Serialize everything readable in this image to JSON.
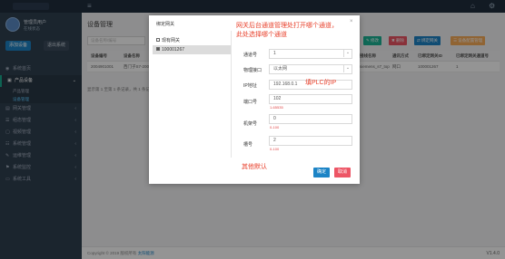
{
  "topbar": {
    "menu_icon": "≡",
    "home_icon": "⌂",
    "user_icon": "⚙"
  },
  "sidebar": {
    "user_name": "管理员用户",
    "user_status": "在线状态",
    "btn_primary": "添加设备",
    "btn_secondary": "退出系统",
    "items": [
      {
        "icon": "◉",
        "label": "系统首页",
        "chevron": ""
      },
      {
        "icon": "▣",
        "label": "产品设备",
        "chevron": "⌄"
      },
      {
        "icon": "",
        "label": "产品管理",
        "chevron": ""
      },
      {
        "icon": "",
        "label": "设备管理",
        "chevron": ""
      },
      {
        "icon": "▤",
        "label": "网关管理",
        "chevron": "‹"
      },
      {
        "icon": "☰",
        "label": "组态管理",
        "chevron": "‹"
      },
      {
        "icon": "▢",
        "label": "视频管理",
        "chevron": "‹"
      },
      {
        "icon": "☷",
        "label": "系统管理",
        "chevron": "‹"
      },
      {
        "icon": "✎",
        "label": "运维管理",
        "chevron": "‹"
      },
      {
        "icon": "⚑",
        "label": "系统监控",
        "chevron": "‹"
      },
      {
        "icon": "▭",
        "label": "系统工具",
        "chevron": "‹"
      }
    ]
  },
  "main": {
    "title": "设备管理",
    "search_placeholder": "设备名称/编号",
    "toolbar": {
      "edit": "✎ 修改",
      "delete": "✖ 删除",
      "bind": "⇄ 绑定网关",
      "config": "☰ 设备配置管理"
    },
    "table": {
      "headers": [
        "设备编号",
        "设备名称",
        "",
        "",
        "",
        "",
        "",
        "",
        "",
        "接线名称",
        "通讯方式",
        "已绑定网关ID",
        "已绑定网关通道号"
      ],
      "row": [
        "2004901001",
        "西门子S7-200",
        "",
        "",
        "",
        "",
        "",
        "",
        "",
        "siemens_s7_top",
        "网口",
        "100001267",
        "1"
      ]
    },
    "pager": "显示第 1 至第 1 条记录，共 1 条记录",
    "footer_copy": "Copyright © 2019 版权所有 ",
    "footer_link": "太阳能源",
    "version": "V1.4.0"
  },
  "modal": {
    "title": "绑定网关",
    "close": "×",
    "left_items": [
      {
        "label": "现有网关",
        "checked": false
      },
      {
        "label": "100001267",
        "checked": true
      }
    ],
    "fields": {
      "channel_label": "通道号",
      "channel_value": "1",
      "port_label": "物理接口",
      "port_value": "以太网",
      "ip_label": "IP地址",
      "ip_value": "192.168.0.1",
      "portnum_label": "端口号",
      "portnum_value": "102",
      "portnum_hint": "1-65535",
      "rack_label": "机架号",
      "rack_value": "0",
      "rack_hint": "0-100",
      "slot_label": "槽号",
      "slot_value": "2",
      "slot_hint": "0-100"
    },
    "ok": "确定",
    "cancel": "取消"
  },
  "annotations": {
    "top_line1": "网关后台通道管理处打开哪个通道，",
    "top_line2": "此处选择哪个通道",
    "ip_note": "填PLC的IP",
    "bottom_note": "其他默认"
  },
  "colors": {
    "primary": "#1c84c6",
    "danger": "#ed5565",
    "warning": "#f8ac59",
    "success": "#1ab394",
    "annotation": "#e8412c",
    "sidebar_bg": "#2f4050",
    "topbar_bg": "#1f2d3d"
  }
}
